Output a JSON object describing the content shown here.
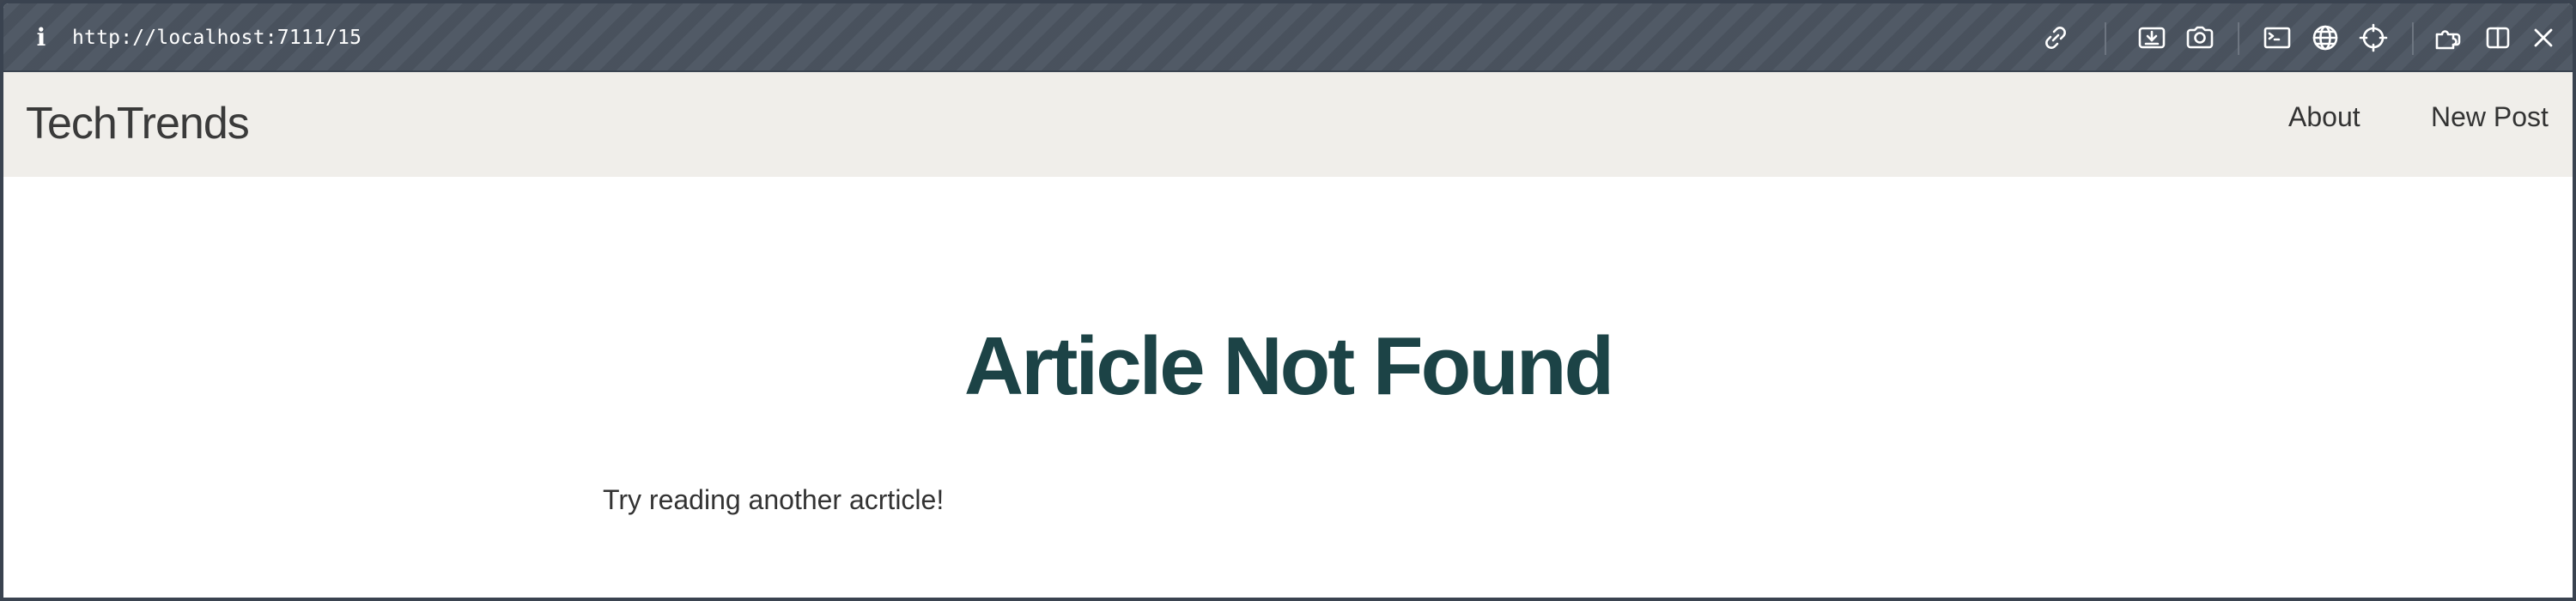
{
  "browser": {
    "info_icon": "i",
    "url": "http://localhost:7111/15",
    "toolbar_icons": [
      "link-icon",
      "download-icon",
      "camera-icon",
      "terminal-icon",
      "globe-icon",
      "crosshair-icon",
      "extensions-icon",
      "split-view-icon",
      "close-icon"
    ]
  },
  "navbar": {
    "brand": "TechTrends",
    "links": [
      {
        "label": "About"
      },
      {
        "label": "New Post"
      }
    ]
  },
  "main": {
    "title": "Article Not Found",
    "message": "Try reading another acrticle!"
  },
  "colors": {
    "toolbar_bg": "#4b5460",
    "navbar_bg": "#f0eeea",
    "title": "#1c4346",
    "text": "#333333"
  }
}
